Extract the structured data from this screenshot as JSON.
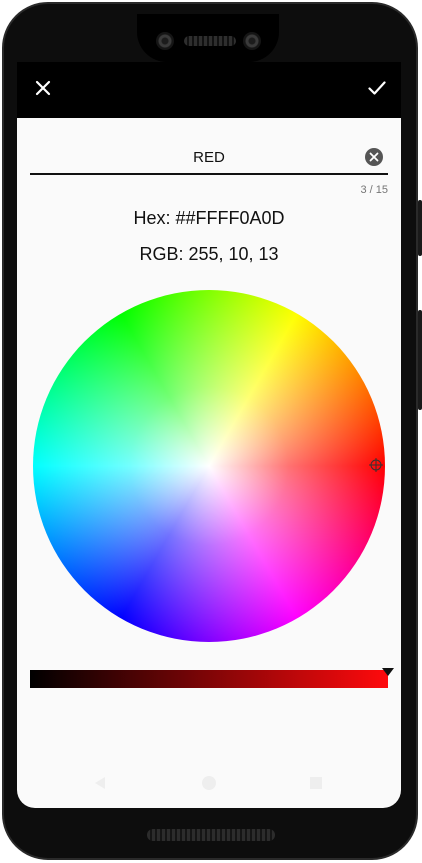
{
  "appbar": {
    "close_icon": "close-icon",
    "confirm_icon": "check-icon"
  },
  "name_field": {
    "value": "RED",
    "clear_icon": "clear-circle-icon"
  },
  "counter": "3 / 15",
  "hex_text": "Hex: ##FFFF0A0D",
  "rgb_text": "RGB: 255, 10, 13",
  "selected_color": "#ff0a0d",
  "value_slider": {
    "start_color": "#000000",
    "end_color": "#ff0a0d",
    "level": 1.0
  },
  "navbar": {
    "icons": [
      "back-icon",
      "home-icon",
      "recents-icon"
    ]
  }
}
